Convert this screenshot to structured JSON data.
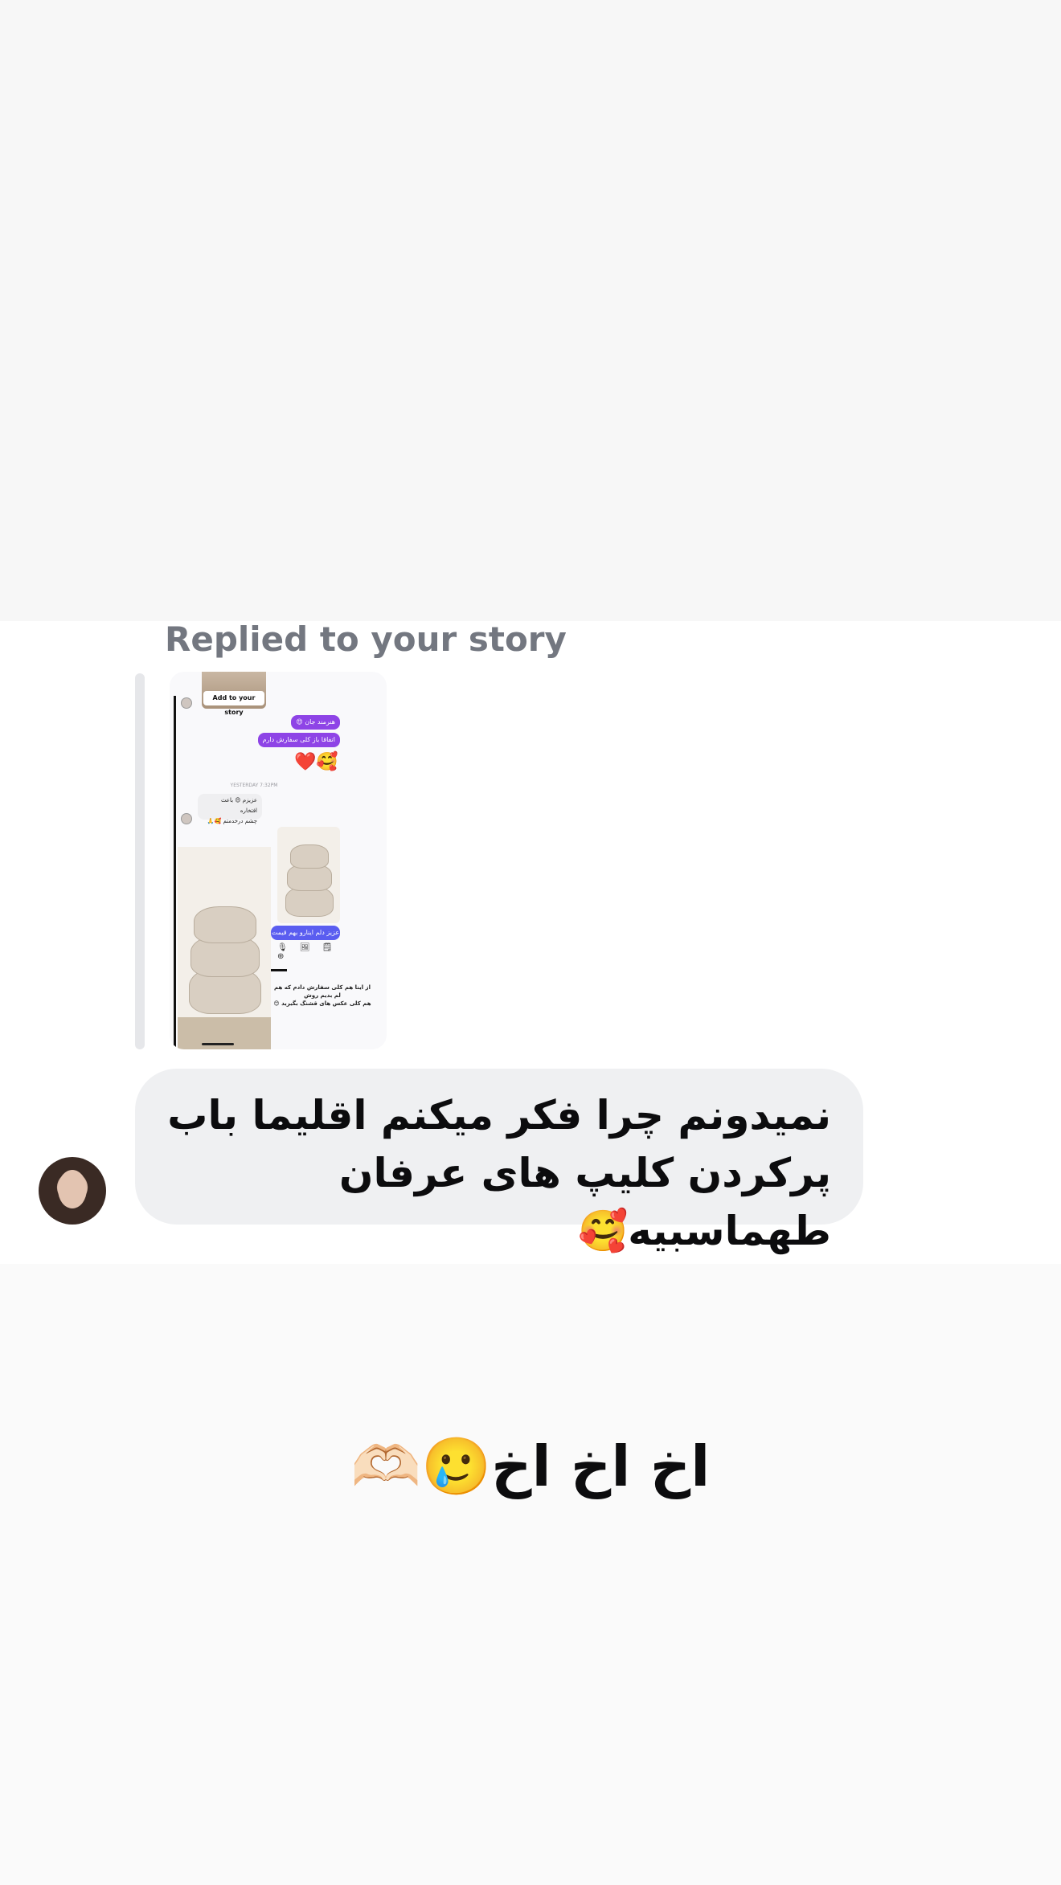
{
  "reply": {
    "label": "Replied to your story"
  },
  "story_preview": {
    "add_story_label": "Add to your story",
    "purple_messages": [
      "هنرمند جان 😍",
      "اتفاقا باز کلی سفارش دارم"
    ],
    "emojis": "❤️🥰",
    "timestamp": "YESTERDAY 7:32PM",
    "grey_message": "عزیزم 😍 باعث افتخاره\nچشم درخدمتم 🥰🙏",
    "blue_message": "عزیز دلم اینارو بهم قیمت",
    "input_icons": "🎙 🖼 🗒 ⊕",
    "caption": "از اینا هم کلی سفارش دادم که هم\nلم بدیم روش\nهم کلی عکس های قشنگ بگیرید 😊"
  },
  "message": {
    "text": "نمیدونم چرا فکر میکنم اقلیما باب پرکردن کلیپ های عرفان طهماسبیه🥰"
  },
  "story_caption": {
    "text": "اخ اخ اخ🥲🫶🏻"
  }
}
